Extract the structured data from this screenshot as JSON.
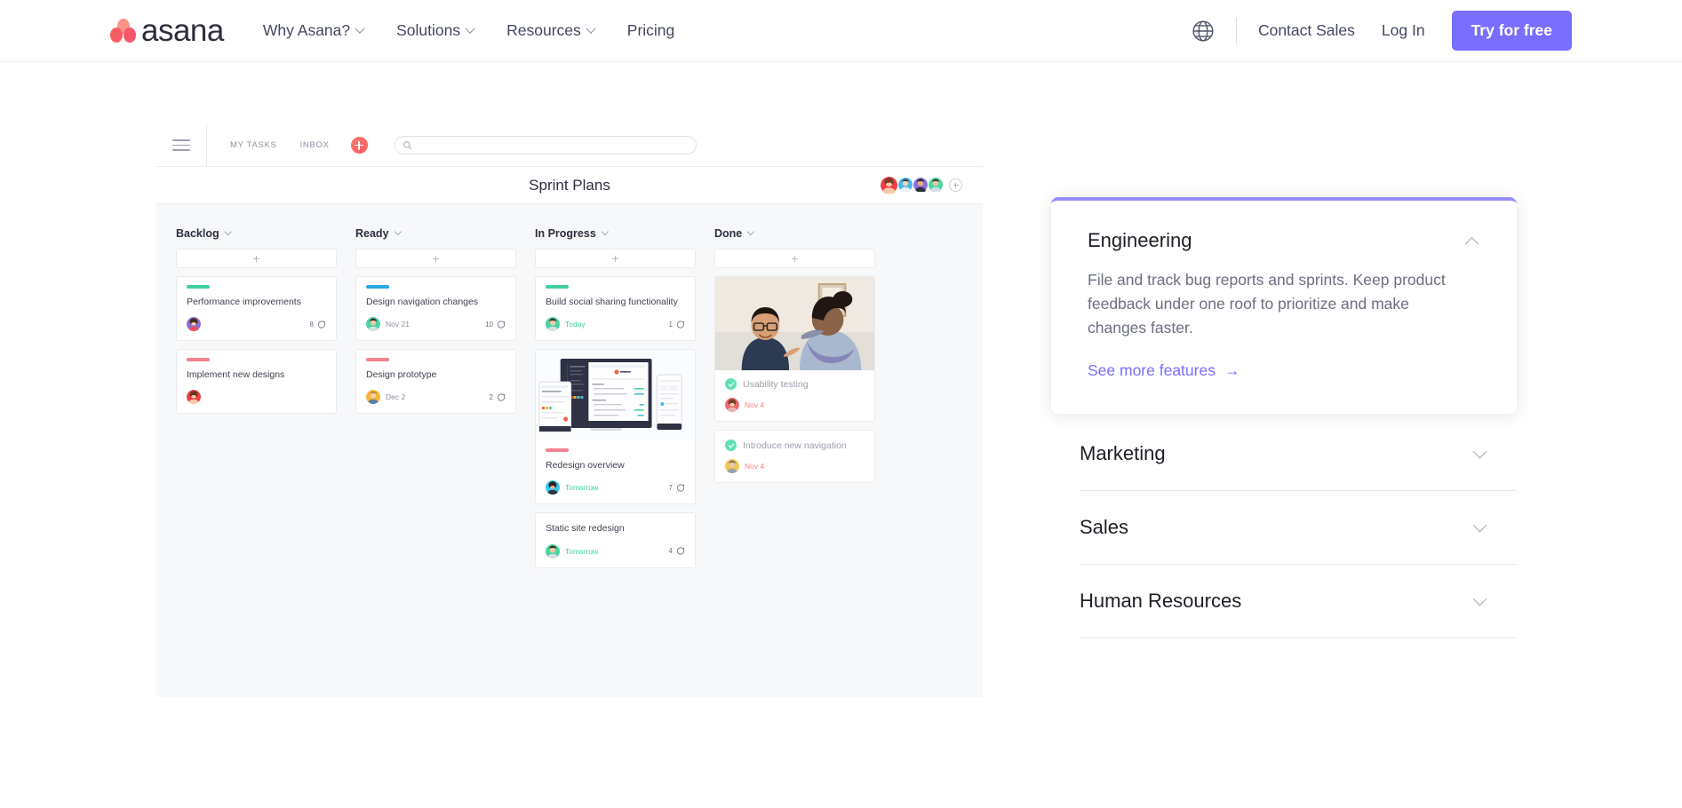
{
  "nav": {
    "logo_text": "asana",
    "logo_icon": "asana-logo-icon",
    "links": [
      {
        "label": "Why Asana?",
        "has_caret": true
      },
      {
        "label": "Solutions",
        "has_caret": true
      },
      {
        "label": "Resources",
        "has_caret": true
      },
      {
        "label": "Pricing",
        "has_caret": false
      }
    ],
    "globe_icon": "globe-icon",
    "contact_sales": "Contact Sales",
    "log_in": "Log In",
    "try_free": "Try for free",
    "accent_color": "#796eff"
  },
  "app": {
    "toolbar": {
      "menu_icon": "hamburger-icon",
      "my_tasks": "MY TASKS",
      "inbox": "INBOX",
      "add_icon": "plus-circle-icon",
      "search_icon": "search-icon",
      "search_value": "",
      "search_placeholder": ""
    },
    "project_title": "Sprint Plans",
    "avatars_count": 4,
    "avatar_add_icon": "add-member-icon",
    "columns": [
      {
        "title": "Backlog",
        "add_label": "+",
        "cards": [
          {
            "title": "Performance improvements",
            "tag_color": "#3ecfa0",
            "date": "",
            "date_state": "",
            "comments": "8",
            "avatar_style": "purple"
          },
          {
            "title": "Implement new designs",
            "tag_color": "#f4828c",
            "date": "",
            "date_state": "",
            "comments": "",
            "avatar_style": "red"
          }
        ]
      },
      {
        "title": "Ready",
        "add_label": "+",
        "cards": [
          {
            "title": "Design navigation changes",
            "tag_color": "#29a9e0",
            "date": "Nov 21",
            "date_state": "normal",
            "comments": "10",
            "avatar_style": "green"
          },
          {
            "title": "Design prototype",
            "tag_color": "#f4828c",
            "date": "Dec 2",
            "date_state": "normal",
            "comments": "2",
            "avatar_style": "yellow"
          }
        ]
      },
      {
        "title": "In Progress",
        "add_label": "+",
        "cards": [
          {
            "title": "Build social sharing functionality",
            "tag_color": "#3ecfa0",
            "date": "Today",
            "date_state": "due",
            "comments": "1",
            "avatar_style": "green"
          },
          {
            "title": "Redesign overview",
            "tag_color": "#f4828c",
            "date": "Tomorrow",
            "date_state": "due",
            "comments": "7",
            "avatar_style": "teal",
            "has_preview": true,
            "preview_icon": "device-mockup-image"
          },
          {
            "title": "Static site redesign",
            "tag_color": "",
            "date": "Tomorrow",
            "date_state": "due",
            "comments": "4",
            "avatar_style": "green"
          }
        ]
      },
      {
        "title": "Done",
        "add_label": "+",
        "cards": [
          {
            "title": "Usability testing",
            "done": true,
            "check_icon": "check-circle-icon",
            "date": "Nov 4",
            "date_state": "overdue",
            "comments": "",
            "avatar_style": "red",
            "has_photo": true,
            "photo_icon": "team-photo-image"
          },
          {
            "title": "Introduce new navigation",
            "done": true,
            "check_icon": "check-circle-icon",
            "date": "Nov 4",
            "date_state": "overdue",
            "comments": "",
            "avatar_style": "yellow"
          }
        ]
      }
    ]
  },
  "accordion": {
    "open": {
      "title": "Engineering",
      "description": "File and track bug reports and sprints. Keep product feedback under one roof to prioritize and make changes faster.",
      "link_label": "See more features",
      "link_arrow": "→",
      "toggle_icon": "chevron-up-icon",
      "accent_color": "#968cff"
    },
    "collapsed": [
      {
        "title": "Marketing",
        "toggle_icon": "chevron-down-icon"
      },
      {
        "title": "Sales",
        "toggle_icon": "chevron-down-icon"
      },
      {
        "title": "Human Resources",
        "toggle_icon": "chevron-down-icon"
      }
    ]
  }
}
